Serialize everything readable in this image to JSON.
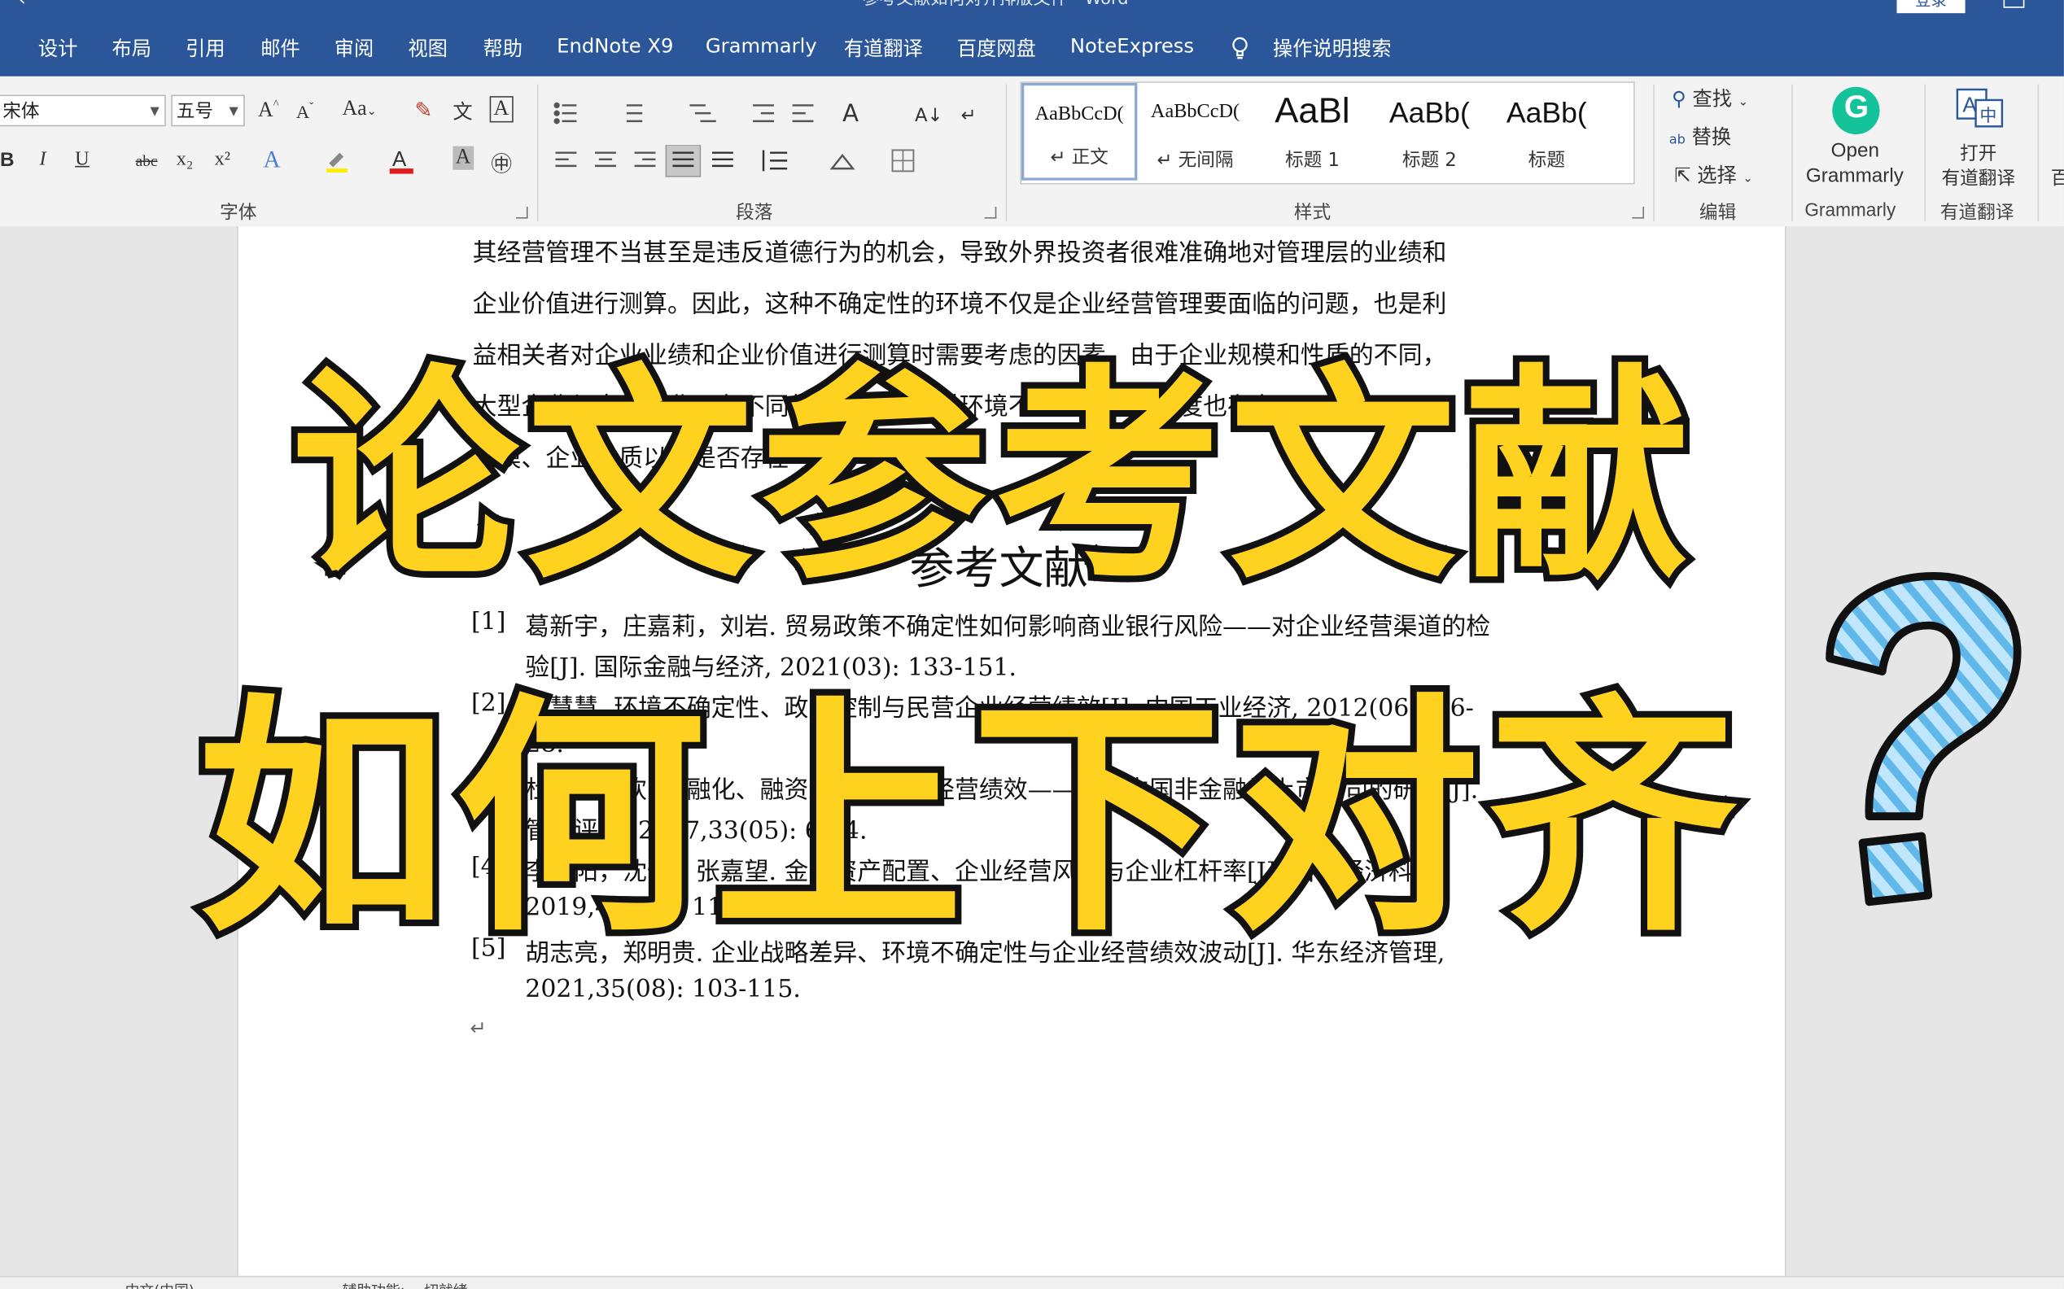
{
  "window": {
    "title": "参考文献如何对齐排版文件 - Word",
    "login_label": "登录"
  },
  "menu": {
    "items": [
      "设计",
      "布局",
      "引用",
      "邮件",
      "审阅",
      "视图",
      "帮助",
      "EndNote X9",
      "Grammarly",
      "有道翻译",
      "百度网盘",
      "NoteExpress"
    ],
    "tell_me": "操作说明搜索"
  },
  "ribbon": {
    "font": {
      "font_name": "宋体",
      "font_size": "五号",
      "group_label": "字体",
      "buttons": [
        "B",
        "I",
        "U",
        "abc",
        "x₂",
        "x²"
      ]
    },
    "paragraph": {
      "group_label": "段落"
    },
    "styles": {
      "group_label": "样式",
      "tiles": [
        {
          "preview": "AaBbCcD(",
          "name": "↵ 正文"
        },
        {
          "preview": "AaBbCcD(",
          "name": "↵ 无间隔"
        },
        {
          "preview": "AaBl",
          "name": "标题 1"
        },
        {
          "preview": "AaBb(",
          "name": "标题 2"
        },
        {
          "preview": "AaBb(",
          "name": "标题"
        }
      ]
    },
    "editing": {
      "group_label": "编辑",
      "find": "查找",
      "replace": "替换",
      "select": "选择"
    },
    "grammarly": {
      "line1": "Open",
      "line2": "Grammarly",
      "group_label": "Grammarly"
    },
    "youdao": {
      "line1": "打开",
      "line2": "有道翻译",
      "group_label": "有道翻译"
    },
    "cut_off": "百"
  },
  "document": {
    "paragraph_lines": [
      "其经营管理不当甚至是违反道德行为的机会，导致外界投资者很难准确地对管理层的业绩和",
      "企业价值进行测算。因此，这种不确定性的环境不仅是企业经营管理要面临的问题，也是利",
      "益相关者对企业业绩和企业价值进行测算时需要考虑的因素。由于企业规模和性质的不同，",
      "大型企业与中小企业具有不同的应对能力，对环境不确定性的敏感度也存在不同，",
      "规模、企业性质以及是否存在"
    ],
    "heading": "参考文献",
    "references": [
      {
        "num": "[1]",
        "lines": [
          "葛新宇，庄嘉莉，刘岩. 贸易政策不确定性如何影响商业银行风险——对企业经营渠道的检",
          "验[J]. 国际金融与经济, 2021(03): 133-151."
        ]
      },
      {
        "num": "[2]",
        "lines": [
          "申慧慧. 环境不确定性、政府控制与民营企业经营绩效[J]. 中国工业经济, 2012(06): 16-",
          "28."
        ]
      },
      {
        "num": "[3]",
        "lines": [
          "杜勇，张欢. 金融化、融资约束与企业经营绩效——基于中国非金融类上市公司的研究[J].",
          "管理评论, 2017,33(05): 6-14."
        ]
      },
      {
        "num": "[4]",
        "lines": [
          "李博阳，沈悦，张嘉望. 金融资产配置、企业经营风险与企业杠杆率[J]. 当代经济科学,",
          "2019,41(05): 116-128."
        ]
      },
      {
        "num": "[5]",
        "lines": [
          "胡志亮，郑明贵. 企业战略差异、环境不确定性与企业经营绩效波动[J]. 华东经济管理,",
          "2021,35(08): 103-115."
        ]
      }
    ]
  },
  "overlay": {
    "line1": "论文参考文献",
    "line2": "如何上下对齐",
    "question_mark": "?"
  },
  "status": {
    "items": [
      "中文(中国)",
      "辅助功能: 一切就绪"
    ]
  },
  "colors": {
    "ribbon_blue": "#2b579a",
    "overlay_yellow": "#ffd21f",
    "question_blue": "#8fd0f2"
  }
}
